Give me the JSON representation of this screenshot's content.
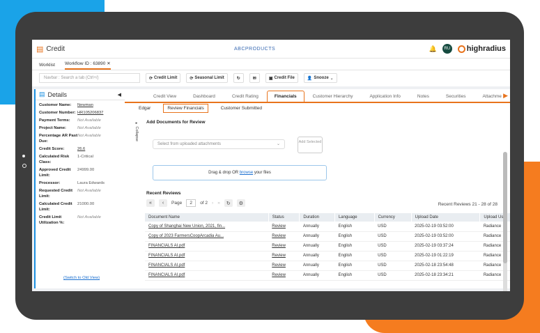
{
  "app": {
    "title": "Credit",
    "brand": "ABCPRODUCTS",
    "user_initials": "RU",
    "company_logo": "highradius"
  },
  "workspace_tabs": [
    {
      "label": "Worklist"
    },
    {
      "label": "Workflow ID : 63890"
    }
  ],
  "toolbar": {
    "search_placeholder": "Navbar : Search a tab (Ctrl+/)",
    "buttons": [
      "Credit Limit",
      "Seasonal Limit",
      "Credit File",
      "Snooze"
    ]
  },
  "details": {
    "title": "Details",
    "fields": [
      {
        "label": "Customer Name:",
        "value": "Newman"
      },
      {
        "label": "Customer Number:",
        "value": "HR105206837"
      },
      {
        "label": "Payment Terms:",
        "value": "Not Available"
      },
      {
        "label": "Project Name:",
        "value": "Not Available"
      },
      {
        "label": "Percentage AR Past Due:",
        "value": "Not Available"
      },
      {
        "label": "Credit Score:",
        "value": "26.6"
      },
      {
        "label": "Calculated Risk Class:",
        "value": "1-Critical"
      },
      {
        "label": "Approved Credit Limit:",
        "value": "24999.00"
      },
      {
        "label": "Processor:",
        "value": "Laura Edwards"
      },
      {
        "label": "Requested Credit Limit:",
        "value": "Not Available"
      },
      {
        "label": "Calculated Credit Limit:",
        "value": "21000.00"
      },
      {
        "label": "Credit Limit Utilization %:",
        "value": "Not Available"
      }
    ],
    "switch_link": "Switch to Old View"
  },
  "main_tabs": [
    "Credit View",
    "Dashboard",
    "Credit Rating",
    "Financials",
    "Customer Hierarchy",
    "Application Info",
    "Notes",
    "Securities",
    "Attachme"
  ],
  "sub_tabs": [
    "Edgar",
    "Review Financials",
    "Customer Submitted"
  ],
  "collapse_label": "Collapse",
  "add_documents": {
    "heading": "Add Documents for Review",
    "select_placeholder": "Select from uploaded attachments",
    "add_button": "Add Selected",
    "drop_text": "Drag & drop OR",
    "browse": "browse",
    "drop_suffix": "your files"
  },
  "recent": {
    "heading": "Recent Reviews",
    "page_label": "Page",
    "page": "2",
    "of": "of 2",
    "count": "Recent Reviews 21 - 28 of 28",
    "columns": [
      "Document Name",
      "Status",
      "Duration",
      "Language",
      "Currency",
      "Upload Date",
      "Upload Us"
    ],
    "rows": [
      [
        "Copy of Shanghai New Union, 2021, fin...",
        "Review",
        "Annually",
        "English",
        "USD",
        "2025-02-19 03:52:00",
        "Radiance"
      ],
      [
        "Copy of 2023 FarmersCoopArcadia Au...",
        "Review",
        "Annually",
        "English",
        "USD",
        "2025-02-19 03:52:00",
        "Radiance"
      ],
      [
        "FINANCIALS AI.pdf",
        "Review",
        "Annually",
        "English",
        "USD",
        "2025-02-19 03:37:24",
        "Radiance"
      ],
      [
        "FINANCIALS AI.pdf",
        "Review",
        "Annually",
        "English",
        "USD",
        "2025-02-19 01:22:19",
        "Radiance"
      ],
      [
        "FINANCIALS AI.pdf",
        "Review",
        "Annually",
        "English",
        "USD",
        "2025-02-18 23:54:48",
        "Radiance"
      ],
      [
        "FINANCIALS AI.pdf",
        "Review",
        "Annually",
        "English",
        "USD",
        "2025-02-18 23:34:21",
        "Radiance"
      ]
    ]
  }
}
